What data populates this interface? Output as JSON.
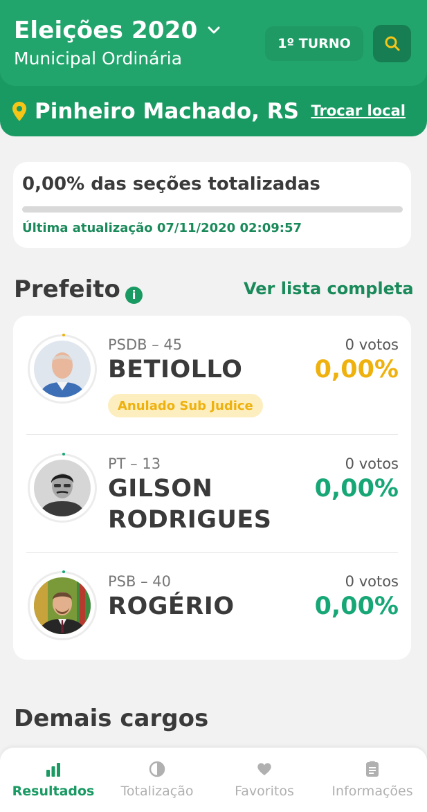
{
  "header": {
    "title": "Eleições 2020",
    "subtitle": "Municipal Ordinária",
    "turno_label": "1º TURNO",
    "location": "Pinheiro Machado, RS",
    "change_location_label": "Trocar local"
  },
  "progress": {
    "title": "0,00% das seções totalizadas",
    "percent": 0,
    "updated": "Última atualização 07/11/2020 02:09:57"
  },
  "prefeito": {
    "title": "Prefeito",
    "info_icon_text": "i",
    "see_all_label": "Ver lista completa",
    "candidates": [
      {
        "party": "PSDB – 45",
        "name": "BETIOLLO",
        "votes": "0 votos",
        "percent": "0,00%",
        "percent_color": "#eeb10e",
        "badge": "Anulado Sub Judice"
      },
      {
        "party": "PT – 13",
        "name": "GILSON RODRIGUES",
        "votes": "0 votos",
        "percent": "0,00%",
        "percent_color": "#17a777"
      },
      {
        "party": "PSB – 40",
        "name": "ROGÉRIO",
        "votes": "0 votos",
        "percent": "0,00%",
        "percent_color": "#17a777"
      }
    ]
  },
  "demais_cargos": {
    "title": "Demais cargos"
  },
  "bottom_nav": {
    "items": [
      {
        "label": "Resultados",
        "icon": "bar-chart-icon",
        "active": true
      },
      {
        "label": "Totalização",
        "icon": "pie-chart-icon",
        "active": false
      },
      {
        "label": "Favoritos",
        "icon": "heart-icon",
        "active": false
      },
      {
        "label": "Informações",
        "icon": "clipboard-icon",
        "active": false
      }
    ]
  },
  "colors": {
    "primary": "#22a56c",
    "primary_dark": "#1a9a63",
    "warning": "#eeb10e",
    "success": "#17a777"
  }
}
